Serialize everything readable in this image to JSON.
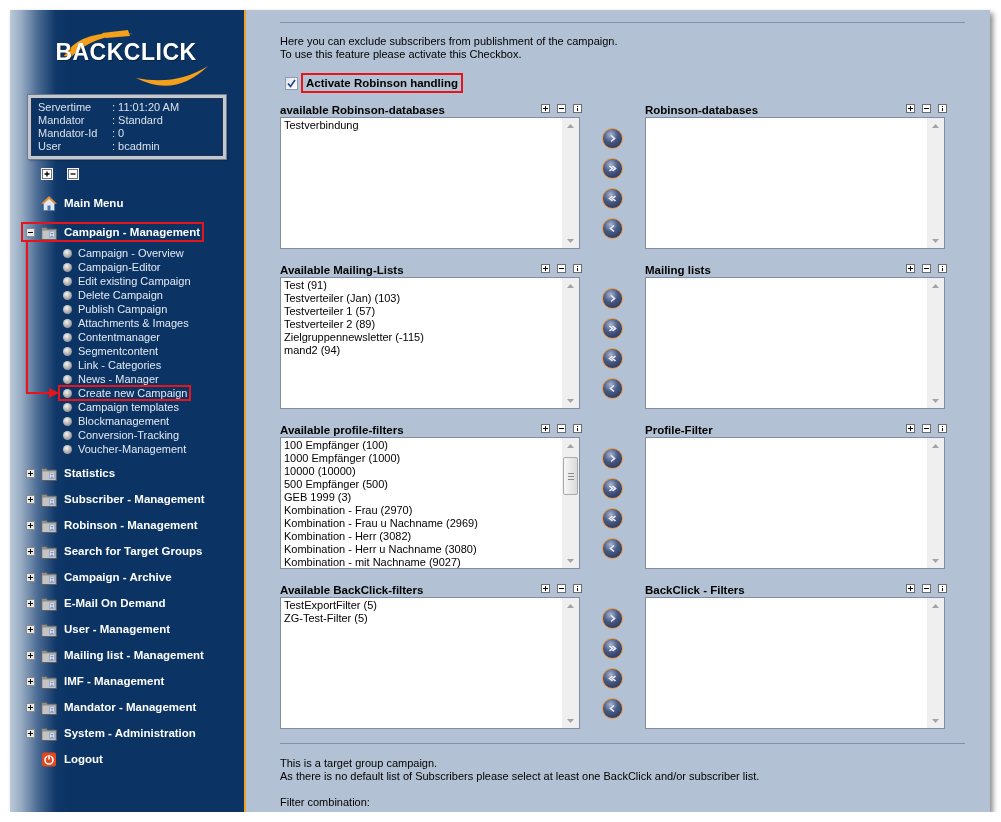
{
  "sidebar": {
    "logo": "BACKCLICK",
    "info": [
      {
        "label": "Servertime",
        "value": ": 11:01:20 AM"
      },
      {
        "label": "Mandator",
        "value": ": Standard"
      },
      {
        "label": "Mandator-Id",
        "value": ": 0"
      },
      {
        "label": "User",
        "value": ": bcadmin"
      }
    ],
    "menu": [
      {
        "kind": "home",
        "label": "Main Menu",
        "highlighted": false
      },
      {
        "kind": "folder",
        "label": "Campaign - Management",
        "expanded": true,
        "highlighted": true,
        "children": [
          {
            "label": "Campaign - Overview",
            "highlighted": false
          },
          {
            "label": "Campaign-Editor",
            "highlighted": false
          },
          {
            "label": "Edit existing Campaign",
            "highlighted": false
          },
          {
            "label": "Delete Campaign",
            "highlighted": false
          },
          {
            "label": "Publish Campaign",
            "highlighted": false
          },
          {
            "label": "Attachments & Images",
            "highlighted": false
          },
          {
            "label": "Contentmanager",
            "highlighted": false
          },
          {
            "label": "Segmentcontent",
            "highlighted": false
          },
          {
            "label": "Link - Categories",
            "highlighted": false
          },
          {
            "label": "News - Manager",
            "highlighted": false
          },
          {
            "label": "Create new Campaign",
            "highlighted": true
          },
          {
            "label": "Campaign templates",
            "highlighted": false
          },
          {
            "label": "Blockmanagement",
            "highlighted": false
          },
          {
            "label": "Conversion-Tracking",
            "highlighted": false
          },
          {
            "label": "Voucher-Management",
            "highlighted": false
          }
        ]
      },
      {
        "kind": "folder",
        "label": "Statistics",
        "expanded": false,
        "highlighted": false
      },
      {
        "kind": "folder",
        "label": "Subscriber - Management",
        "expanded": false,
        "highlighted": false
      },
      {
        "kind": "folder",
        "label": "Robinson - Management",
        "expanded": false,
        "highlighted": false
      },
      {
        "kind": "folder",
        "label": "Search for Target Groups",
        "expanded": false,
        "highlighted": false
      },
      {
        "kind": "folder",
        "label": "Campaign - Archive",
        "expanded": false,
        "highlighted": false
      },
      {
        "kind": "folder",
        "label": "E-Mail On Demand",
        "expanded": false,
        "highlighted": false
      },
      {
        "kind": "folder",
        "label": "User - Management",
        "expanded": false,
        "highlighted": false
      },
      {
        "kind": "folder",
        "label": "Mailing list - Management",
        "expanded": false,
        "highlighted": false
      },
      {
        "kind": "folder",
        "label": "IMF - Management",
        "expanded": false,
        "highlighted": false
      },
      {
        "kind": "folder",
        "label": "Mandator - Management",
        "expanded": false,
        "highlighted": false
      },
      {
        "kind": "folder",
        "label": "System - Administration",
        "expanded": false,
        "highlighted": false
      },
      {
        "kind": "logout",
        "label": "Logout",
        "highlighted": false
      }
    ]
  },
  "main": {
    "intro": [
      "Here you can exclude subscribers from publishment of the campaign.",
      "To use this feature please activate this Checkbox."
    ],
    "robinson_checkbox": {
      "label": "Activate Robinson handling",
      "checked": true,
      "highlighted": true
    },
    "selectors": [
      {
        "available": {
          "title": "available Robinson-databases",
          "options": [
            {
              "label": "Testverbindung",
              "selected": false
            }
          ]
        },
        "chosen": {
          "title": "Robinson-databases"
        }
      },
      {
        "available": {
          "title": "Available Mailing-Lists",
          "options": [
            {
              "label": "Test (91)",
              "selected": false
            },
            {
              "label": "Testverteiler (Jan) (103)",
              "selected": false
            },
            {
              "label": "Testverteiler 1 (57)",
              "selected": false
            },
            {
              "label": "Testverteiler 2 (89)",
              "selected": false
            },
            {
              "label": "Zielgruppennewsletter (-115)",
              "selected": false
            },
            {
              "label": "mand2 (94)",
              "selected": false
            }
          ]
        },
        "chosen": {
          "title": "Mailing lists"
        }
      },
      {
        "available": {
          "title": "Available profile-filters",
          "options": [
            {
              "label": "100 Empfänger (100)",
              "selected": false
            },
            {
              "label": "1000 Empfänger (1000)",
              "selected": false
            },
            {
              "label": "10000 (10000)",
              "selected": false
            },
            {
              "label": "500 Empfänger (500)",
              "selected": false
            },
            {
              "label": "GEB 1999 (3)",
              "selected": false
            },
            {
              "label": "Kombination - Frau (2970)",
              "selected": false
            },
            {
              "label": "Kombination - Frau u Nachname (2969)",
              "selected": false
            },
            {
              "label": "Kombination - Herr (3082)",
              "selected": false
            },
            {
              "label": "Kombination - Herr u Nachname (3080)",
              "selected": false
            },
            {
              "label": "Kombination - mit Nachname (9027)",
              "selected": false
            }
          ]
        },
        "chosen": {
          "title": "Profile-Filter"
        }
      },
      {
        "available": {
          "title": "Available BackClick-filters",
          "options": [
            {
              "label": "TestExportFilter (5)",
              "selected": false
            },
            {
              "label": "ZG-Test-Filter (5)",
              "selected": false
            }
          ]
        },
        "chosen": {
          "title": "BackClick - Filters"
        }
      }
    ],
    "notes": [
      "This is a target group campaign.",
      "As there is no default list of Subscribers please select at least one BackClick and/or subscriber list."
    ],
    "filter_label": "Filter combination:"
  }
}
